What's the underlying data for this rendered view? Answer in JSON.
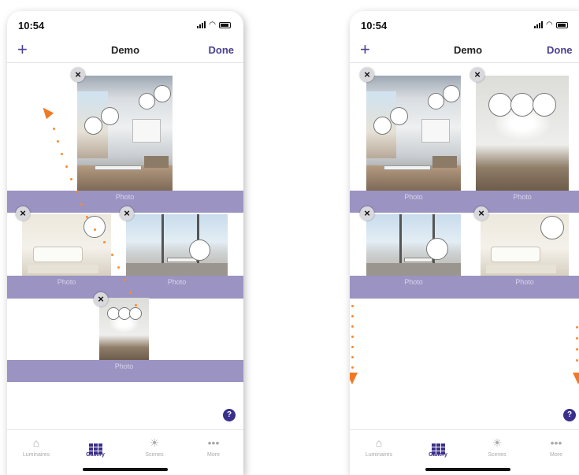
{
  "status_bar": {
    "time": "10:54"
  },
  "navbar": {
    "add_label": "+",
    "title": "Demo",
    "done_label": "Done"
  },
  "photo_label": "Photo",
  "delete_glyph": "×",
  "help_glyph": "?",
  "tabs": [
    {
      "label": "Luminaires",
      "icon": "luminaire-icon",
      "glyph": "⌂"
    },
    {
      "label": "Gallery",
      "icon": "gallery-grid-icon",
      "glyph": ""
    },
    {
      "label": "Scenes",
      "icon": "scenes-sun-icon",
      "glyph": "☀"
    },
    {
      "label": "More",
      "icon": "more-dots-icon",
      "glyph": "•••"
    }
  ],
  "active_tab": "Gallery",
  "colors": {
    "accent": "#3a2f8a",
    "band": "#9b93c2",
    "arrow": "#f07a24"
  }
}
